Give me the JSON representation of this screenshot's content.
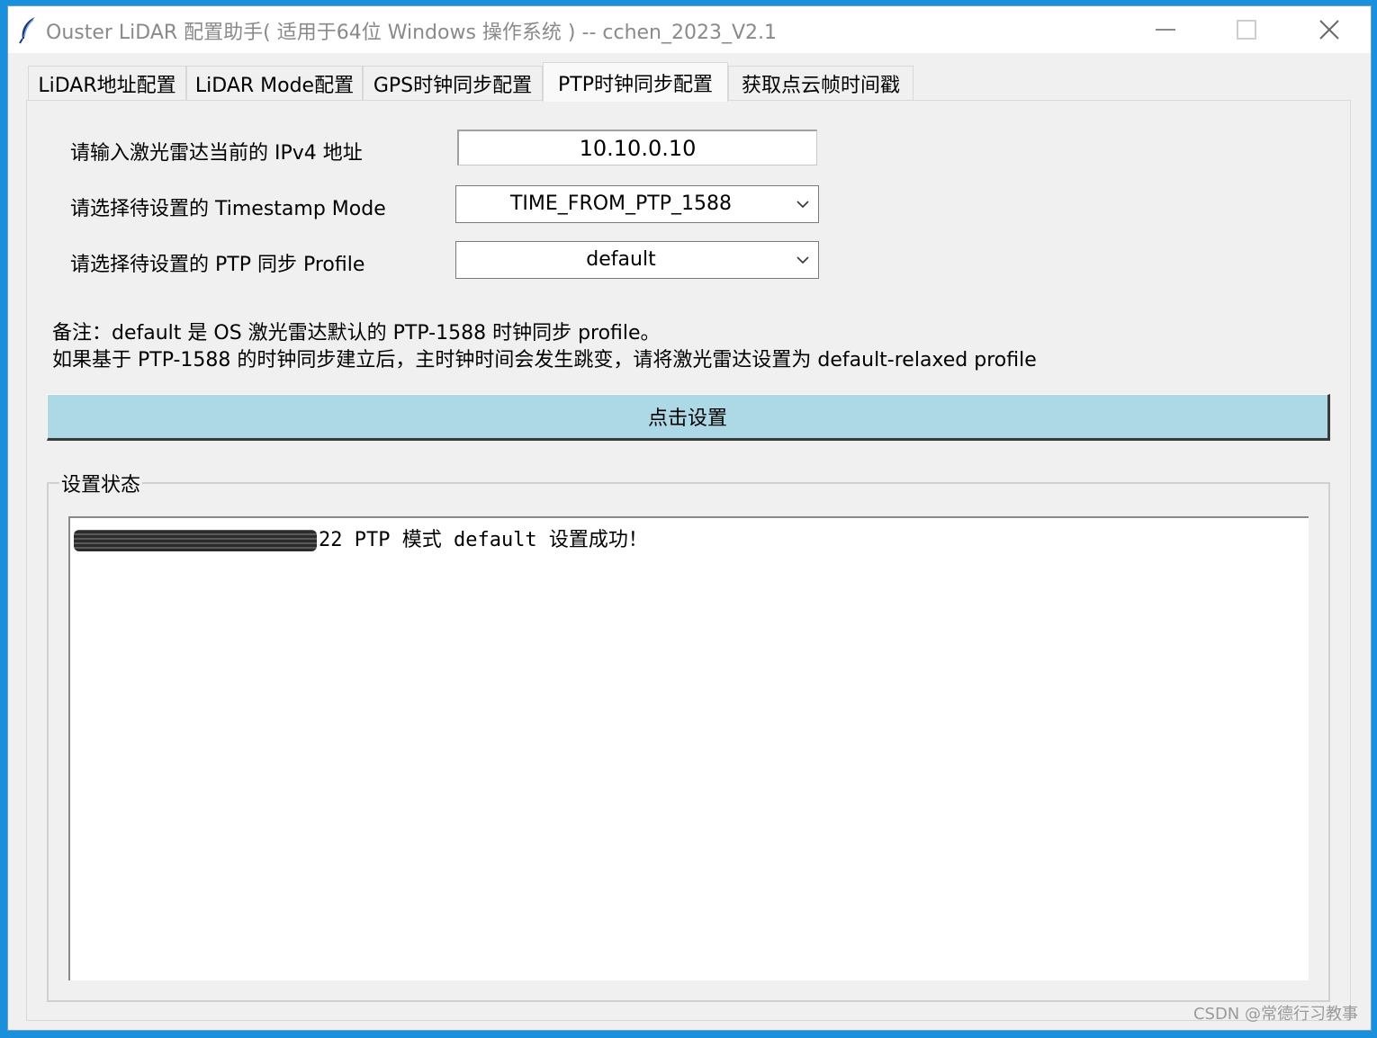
{
  "window": {
    "title": "Ouster LiDAR 配置助手( 适用于64位 Windows 操作系统 ) -- cchen_2023_V2.1",
    "title_icon": "feather-icon",
    "controls": [
      "minimize-icon",
      "maximize-icon",
      "close-icon"
    ]
  },
  "tabs": [
    {
      "label": "LiDAR地址配置",
      "active": false
    },
    {
      "label": "LiDAR Mode配置",
      "active": false
    },
    {
      "label": "GPS时钟同步配置",
      "active": false
    },
    {
      "label": "PTP时钟同步配置",
      "active": true
    },
    {
      "label": "获取点云帧时间戳",
      "active": false
    }
  ],
  "form": {
    "ip_label": "请输入激光雷达当前的 IPv4 地址",
    "ip_value": "10.10.0.10",
    "timestamp_mode_label": "请选择待设置的 Timestamp Mode",
    "timestamp_mode_value": "TIME_FROM_PTP_1588",
    "ptp_profile_label": "请选择待设置的 PTP 同步 Profile",
    "ptp_profile_value": "default"
  },
  "notes": {
    "line1": "备注：default 是 OS 激光雷达默认的 PTP-1588 时钟同步 profile。",
    "line2": "如果基于 PTP-1588 的时钟同步建立后，主时钟时间会发生跳变，请将激光雷达设置为 default-relaxed profile"
  },
  "set_button_label": "点击设置",
  "status": {
    "group_title": "设置状态",
    "message": "22 PTP 模式 default 设置成功！"
  },
  "watermark": "CSDN @常德行习教事",
  "colors": {
    "desktop": "#1a8fdc",
    "button_bg": "#add8e6"
  }
}
